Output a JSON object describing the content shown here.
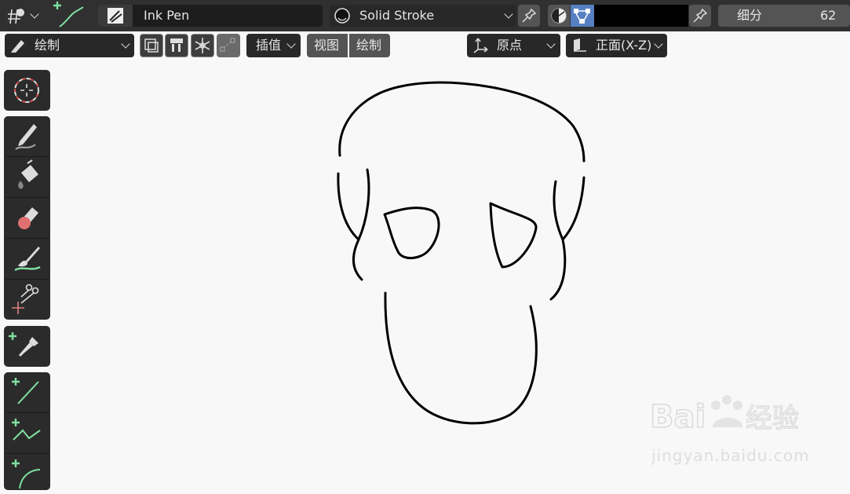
{
  "header": {
    "brush_name": "Ink Pen",
    "material_name": "Solid Stroke",
    "subdivision_label": "细分",
    "subdivision_value": "62",
    "material_color": "#000000",
    "accent_color": "#5680c2"
  },
  "subheader": {
    "mode_label": "绘制",
    "interpolate_label": "插值",
    "view_menu": "视图",
    "draw_menu": "绘制",
    "origin_label": "原点",
    "plane_label": "正面(X-Z)"
  },
  "toolbar": {
    "tools": [
      {
        "name": "cursor",
        "icon": "cursor-icon"
      },
      {
        "name": "draw",
        "icon": "pencil-icon"
      },
      {
        "name": "fill",
        "icon": "fill-bucket-icon"
      },
      {
        "name": "erase",
        "icon": "eraser-icon"
      },
      {
        "name": "tint",
        "icon": "brush-icon"
      },
      {
        "name": "cutter",
        "icon": "scissors-icon"
      },
      {
        "name": "eyedropper",
        "icon": "eyedropper-icon"
      },
      {
        "name": "line",
        "icon": "line-icon"
      },
      {
        "name": "polyline",
        "icon": "polyline-icon"
      },
      {
        "name": "arc",
        "icon": "arc-icon"
      }
    ]
  },
  "watermark": {
    "brand": "Baidu经验",
    "url": "jingyan.baidu.com"
  }
}
